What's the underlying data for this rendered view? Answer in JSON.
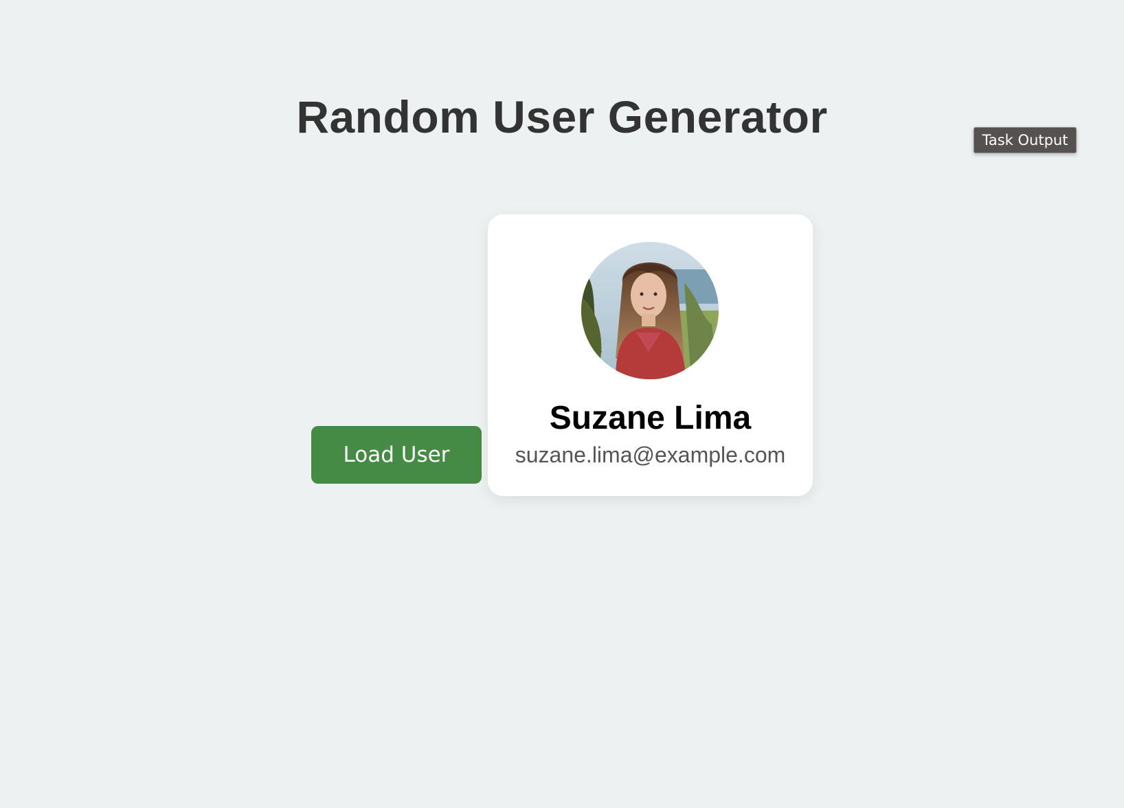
{
  "header": {
    "title": "Random User Generator"
  },
  "task_output": {
    "label": "Task Output"
  },
  "actions": {
    "load_user_label": "Load User"
  },
  "user": {
    "name": "Suzane Lima",
    "email": "suzane.lima@example.com",
    "avatar_icon": "user-photo"
  },
  "colors": {
    "background": "#eef1f2",
    "title": "#333333",
    "button": "#458a45",
    "card": "#ffffff",
    "task_output_bg": "#555150"
  }
}
